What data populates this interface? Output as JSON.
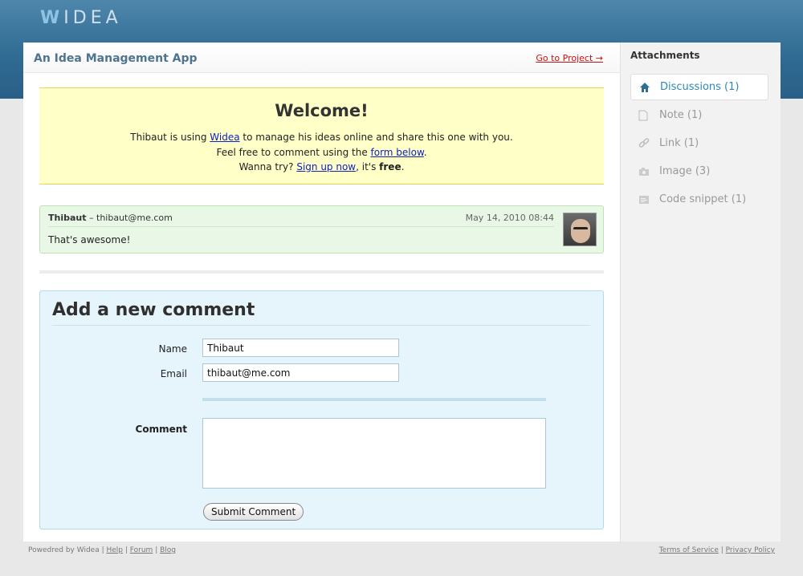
{
  "logo": {
    "first": "W",
    "rest": "IDEA"
  },
  "header": {
    "title": "An Idea Management App",
    "goto_link": "Go to Project →"
  },
  "welcome": {
    "heading": "Welcome!",
    "line1_pre": "Thibaut is using ",
    "line1_link": "Widea",
    "line1_post": " to manage his ideas online and share this one with you.",
    "line2_pre": "Feel free to comment using the ",
    "line2_link": "form below",
    "line2_post": ".",
    "line3_pre": "Wanna try? ",
    "line3_link": "Sign up now",
    "line3_mid": ", it's ",
    "line3_bold": "free",
    "line3_post": "."
  },
  "comment": {
    "author": "Thibaut",
    "separator": " – ",
    "email": "thibaut@me.com",
    "date": "May 14, 2010 08:44",
    "body": "That's awesome!"
  },
  "form": {
    "title": "Add a new comment",
    "name_label": "Name",
    "name_value": "Thibaut",
    "email_label": "Email",
    "email_value": "thibaut@me.com",
    "comment_label": "Comment",
    "comment_value": "",
    "submit_label": "Submit Comment"
  },
  "sidebar": {
    "title": "Attachments",
    "items": [
      {
        "label": "Discussions (1)",
        "icon": "home-icon",
        "active": true
      },
      {
        "label": "Note (1)",
        "icon": "document-icon",
        "active": false
      },
      {
        "label": "Link (1)",
        "icon": "link-icon",
        "active": false
      },
      {
        "label": "Image (3)",
        "icon": "camera-icon",
        "active": false
      },
      {
        "label": "Code snippet (1)",
        "icon": "code-icon",
        "active": false
      }
    ]
  },
  "footer": {
    "powered": "Powedred by Widea",
    "sep": " | ",
    "help": "Help",
    "forum": "Forum",
    "blog": "Blog",
    "terms": "Terms of Service",
    "privacy": "Privacy Policy"
  },
  "colors": {
    "accent": "#2d88b8",
    "header_band": "#2e6a92",
    "welcome_bg": "#ffffc8",
    "comment_bg": "#e9f8e6",
    "form_bg": "#e6f4fb"
  }
}
